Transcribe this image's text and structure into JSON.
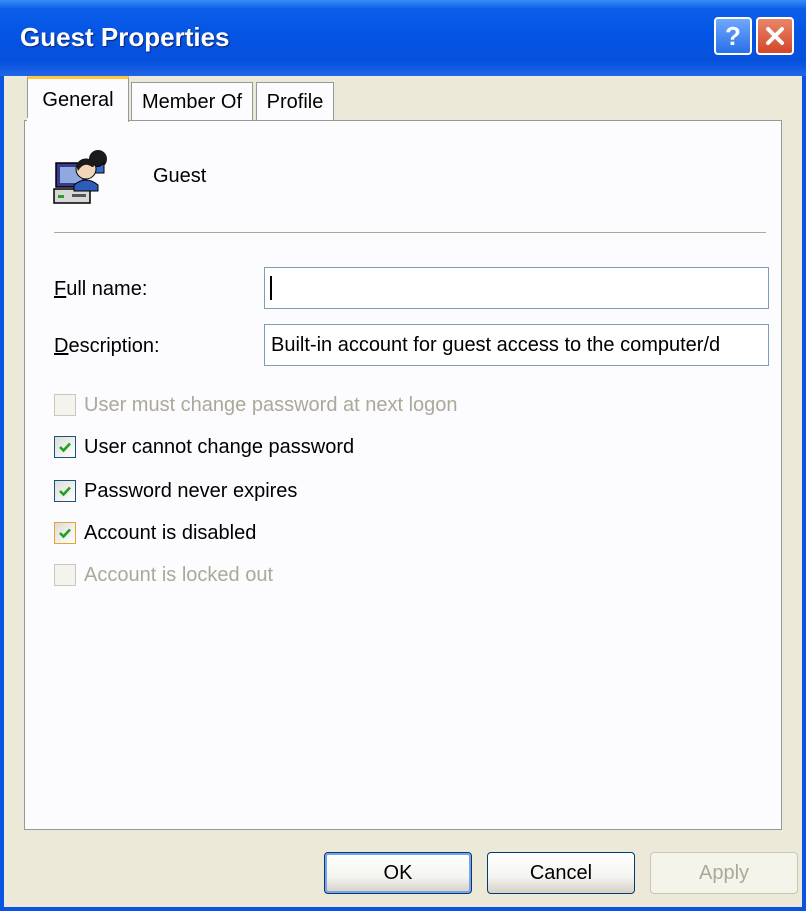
{
  "window": {
    "title": "Guest Properties",
    "help_glyph": "?",
    "close_icon": "close-x-icon"
  },
  "tabs": [
    {
      "label": "General",
      "active": true
    },
    {
      "label": "Member Of",
      "active": false
    },
    {
      "label": "Profile",
      "active": false
    }
  ],
  "user": {
    "icon": "user-account-icon",
    "name": "Guest"
  },
  "fields": {
    "full_name": {
      "label": "Full name:",
      "value": ""
    },
    "description": {
      "label": "Description:",
      "value": "Built-in account for guest access to the computer/d"
    }
  },
  "checkboxes": [
    {
      "label": "User must change password at next logon",
      "checked": false,
      "enabled": false
    },
    {
      "label": "User cannot change password",
      "checked": true,
      "enabled": true
    },
    {
      "label": "Password never expires",
      "checked": true,
      "enabled": true
    },
    {
      "label": "Account is disabled",
      "checked": true,
      "enabled": true
    },
    {
      "label": "Account is locked out",
      "checked": false,
      "enabled": false
    }
  ],
  "buttons": {
    "ok": "OK",
    "cancel": "Cancel",
    "apply": "Apply"
  },
  "colors": {
    "titlebar": "#0554E3",
    "close_button": "#D4462A",
    "active_tab_accent": "#FFC83C",
    "check_mark": "#21A121",
    "dialog_background": "#ECE9D8"
  }
}
